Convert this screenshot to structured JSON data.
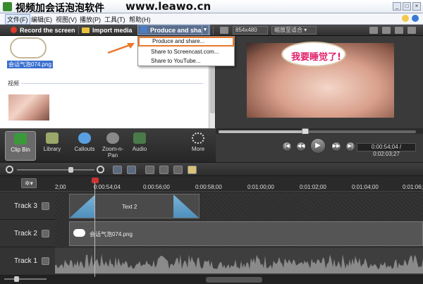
{
  "window": {
    "title": "视频加会话泡泡软件",
    "watermark": "www.leawo.cn"
  },
  "menu": [
    {
      "label": "文件(F)"
    },
    {
      "label": "编辑(E)"
    },
    {
      "label": "视图(V)"
    },
    {
      "label": "播放(P)"
    },
    {
      "label": "工具(T)"
    },
    {
      "label": "帮助(H)"
    }
  ],
  "toolbar": {
    "record_label": "Record the screen",
    "import_label": "Import media",
    "produce_label": "Produce and share",
    "dimensions": "854x480",
    "fit_label": "缩放至适合"
  },
  "produce_menu": {
    "items": [
      {
        "label": "Produce and share..."
      },
      {
        "label": "Share to Screencast.com..."
      },
      {
        "label": "Share to YouTube..."
      }
    ]
  },
  "clip_bin": {
    "image_clip_name": "会话气泡074.png",
    "section_label": "视频"
  },
  "preview": {
    "bubble_text": "我要睡觉了!"
  },
  "tabs": [
    {
      "label": "Clip Bin",
      "icon": "clip-bin-icon"
    },
    {
      "label": "Library",
      "icon": "library-icon"
    },
    {
      "label": "Callouts",
      "icon": "callouts-icon"
    },
    {
      "label": "Zoom-n-Pan",
      "icon": "zoom-icon"
    },
    {
      "label": "Audio",
      "icon": "audio-icon"
    },
    {
      "label": "More",
      "icon": "more-icon"
    }
  ],
  "player": {
    "time_display": "0:00:54;04 / 0:02:03;27",
    "playhead_fraction": 0.44
  },
  "ruler": {
    "ticks": [
      "2;00",
      "0:00:54;04",
      "0:00:56;00",
      "0:00:58;00",
      "0:01:00;00",
      "0:01:02;00",
      "0:01:04;00",
      "0:01:06;00"
    ]
  },
  "tracks": [
    {
      "label": "Track 3",
      "clip_label": "Text 2"
    },
    {
      "label": "Track 2",
      "clip_label": "会话气泡074.png"
    },
    {
      "label": "Track 1",
      "clip_label": ""
    }
  ],
  "colors": {
    "accent_orange": "#e8792a",
    "record_red": "#e23b2a",
    "bubble_text": "#e0206a"
  }
}
